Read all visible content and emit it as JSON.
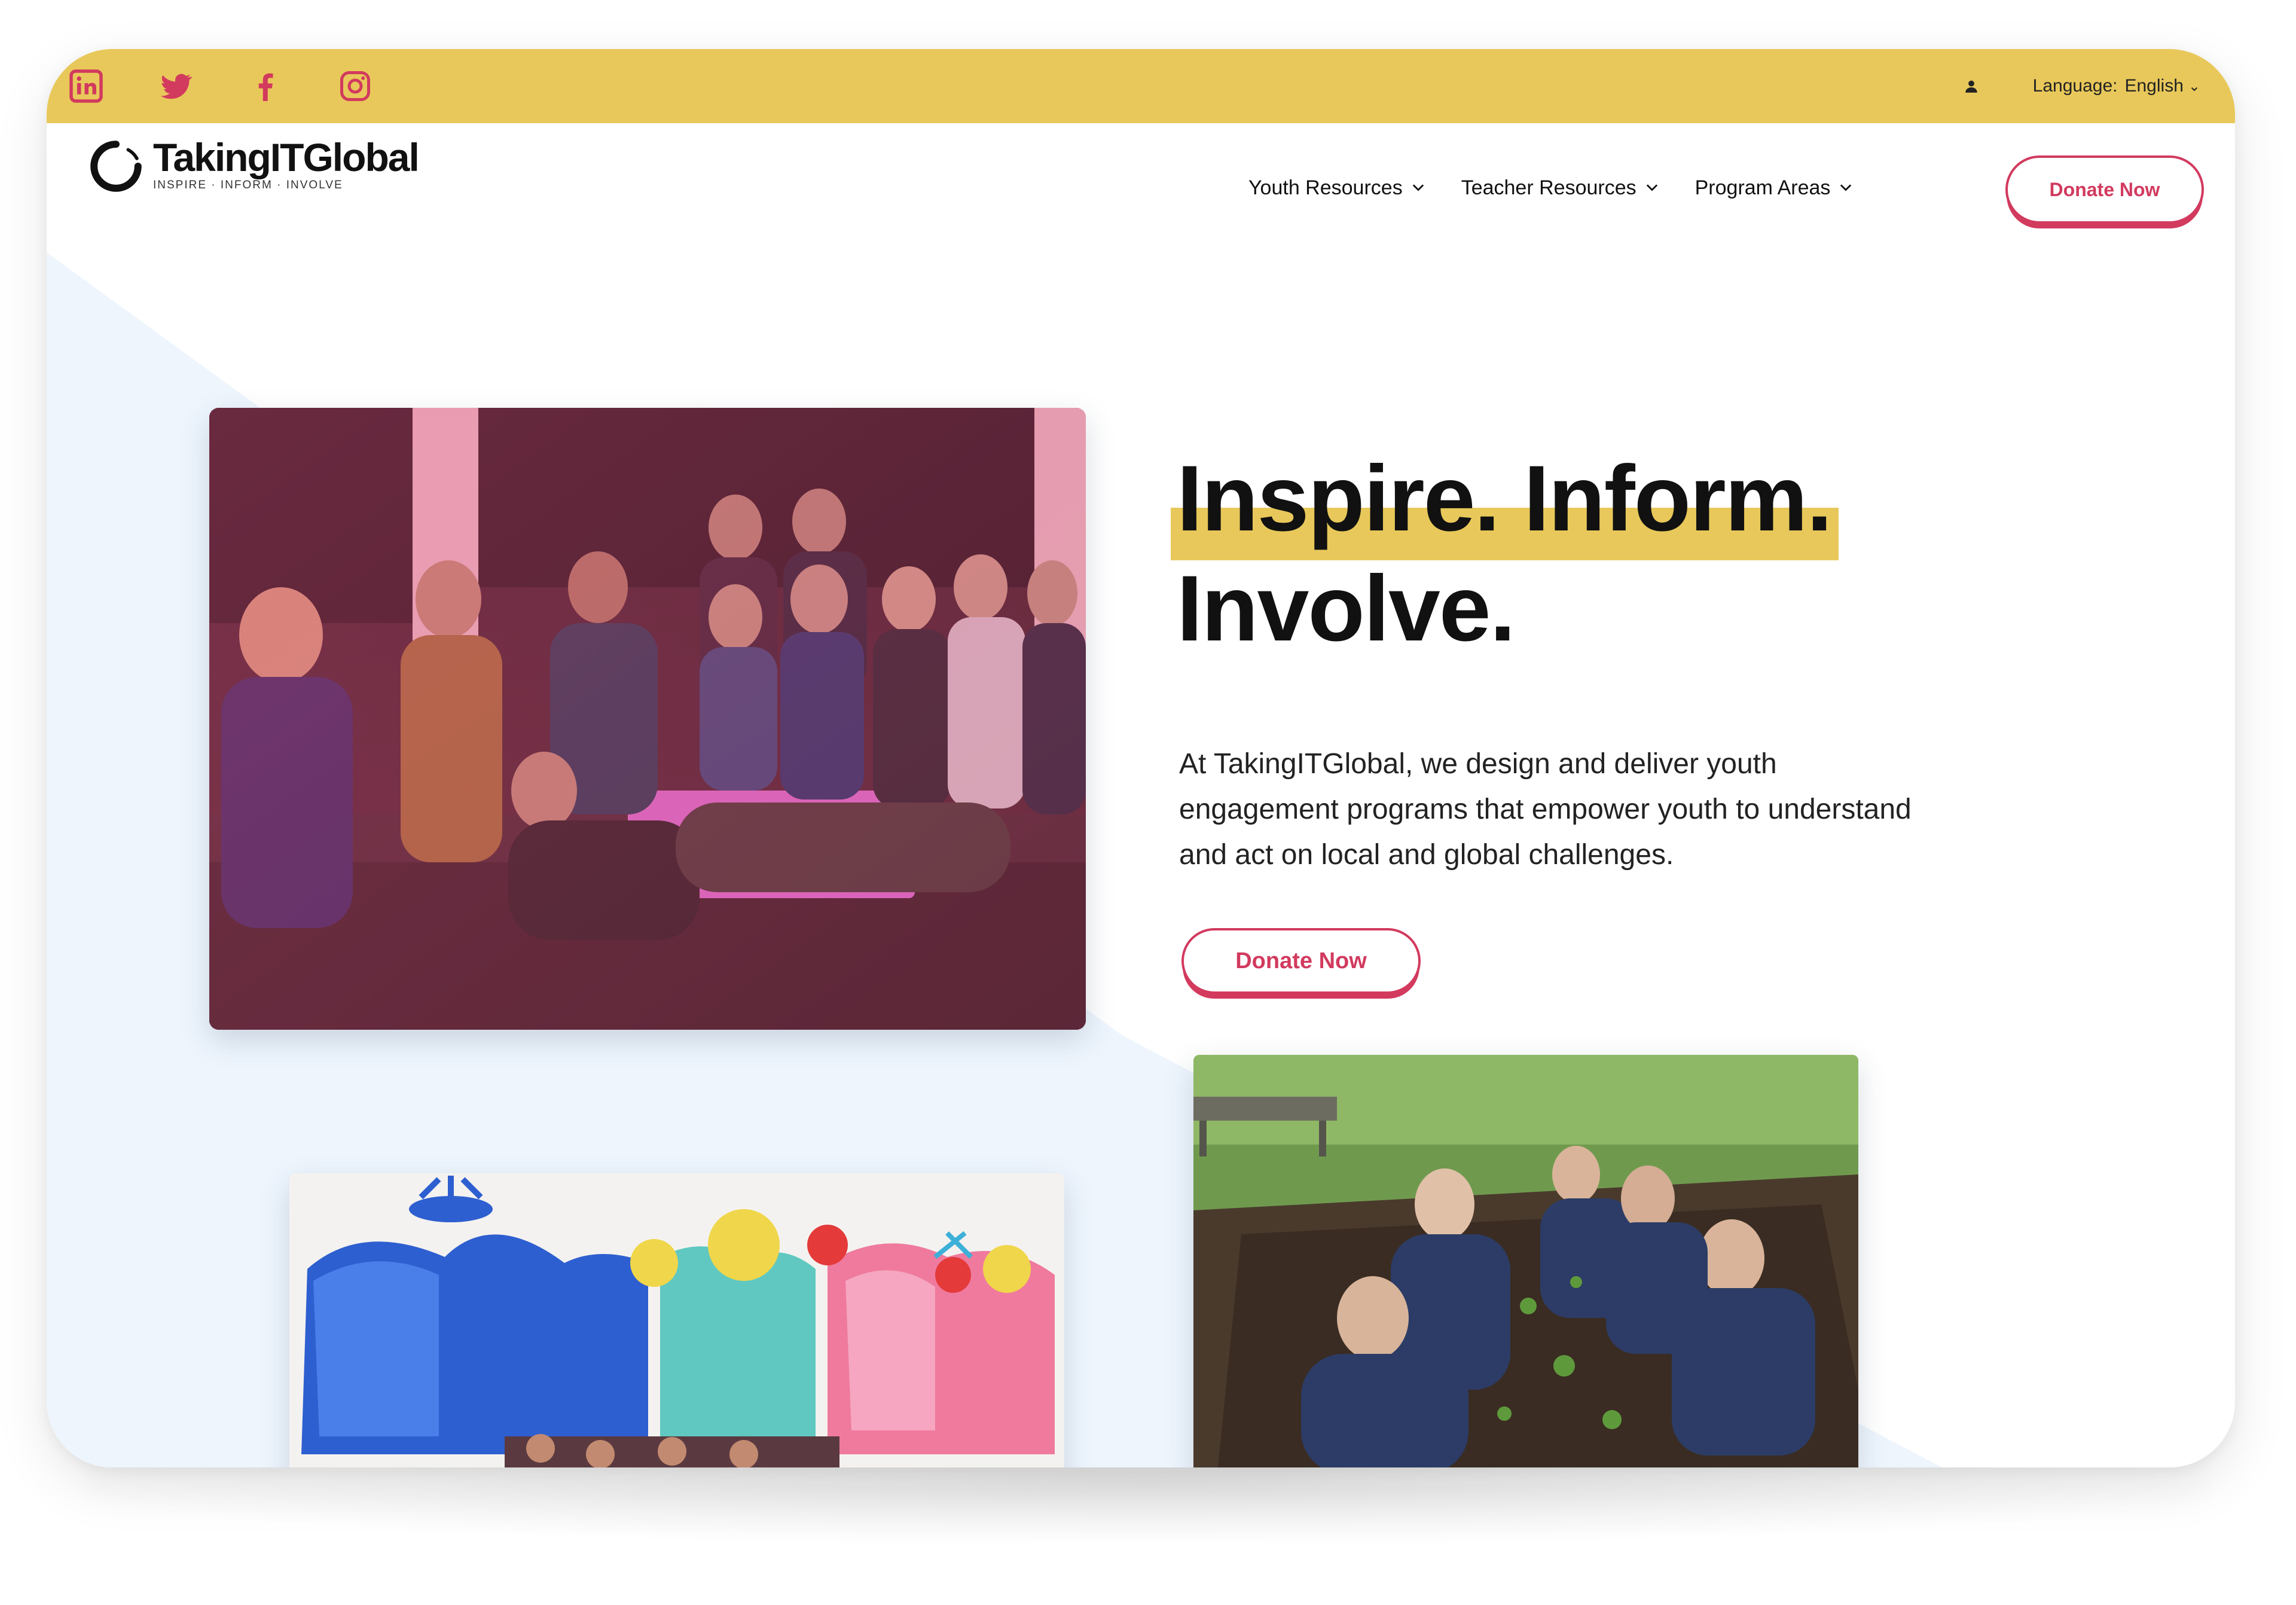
{
  "topbar": {
    "social": [
      {
        "name": "linkedin-icon"
      },
      {
        "name": "twitter-icon"
      },
      {
        "name": "facebook-icon"
      },
      {
        "name": "instagram-icon"
      }
    ],
    "language_label": "Language:",
    "language_value": "English",
    "caret": "⌄"
  },
  "header": {
    "logo_text": "TakingITGlobal",
    "logo_tagline": "INSPIRE · INFORM · INVOLVE",
    "nav": [
      {
        "label": "Youth Resources"
      },
      {
        "label": "Teacher Resources"
      },
      {
        "label": "Program Areas"
      }
    ],
    "donate_label": "Donate Now"
  },
  "hero": {
    "headline_line1": "Inspire. Inform.",
    "headline_line2": "Involve.",
    "description": "At TakingITGlobal, we design and deliver youth engagement programs that empower youth to understand and act on local and global challenges.",
    "donate_label": "Donate Now"
  },
  "colors": {
    "topbar": "#e8c85a",
    "accent": "#d23a5e",
    "hero_bg": "#eef5fd",
    "text": "#111111"
  }
}
